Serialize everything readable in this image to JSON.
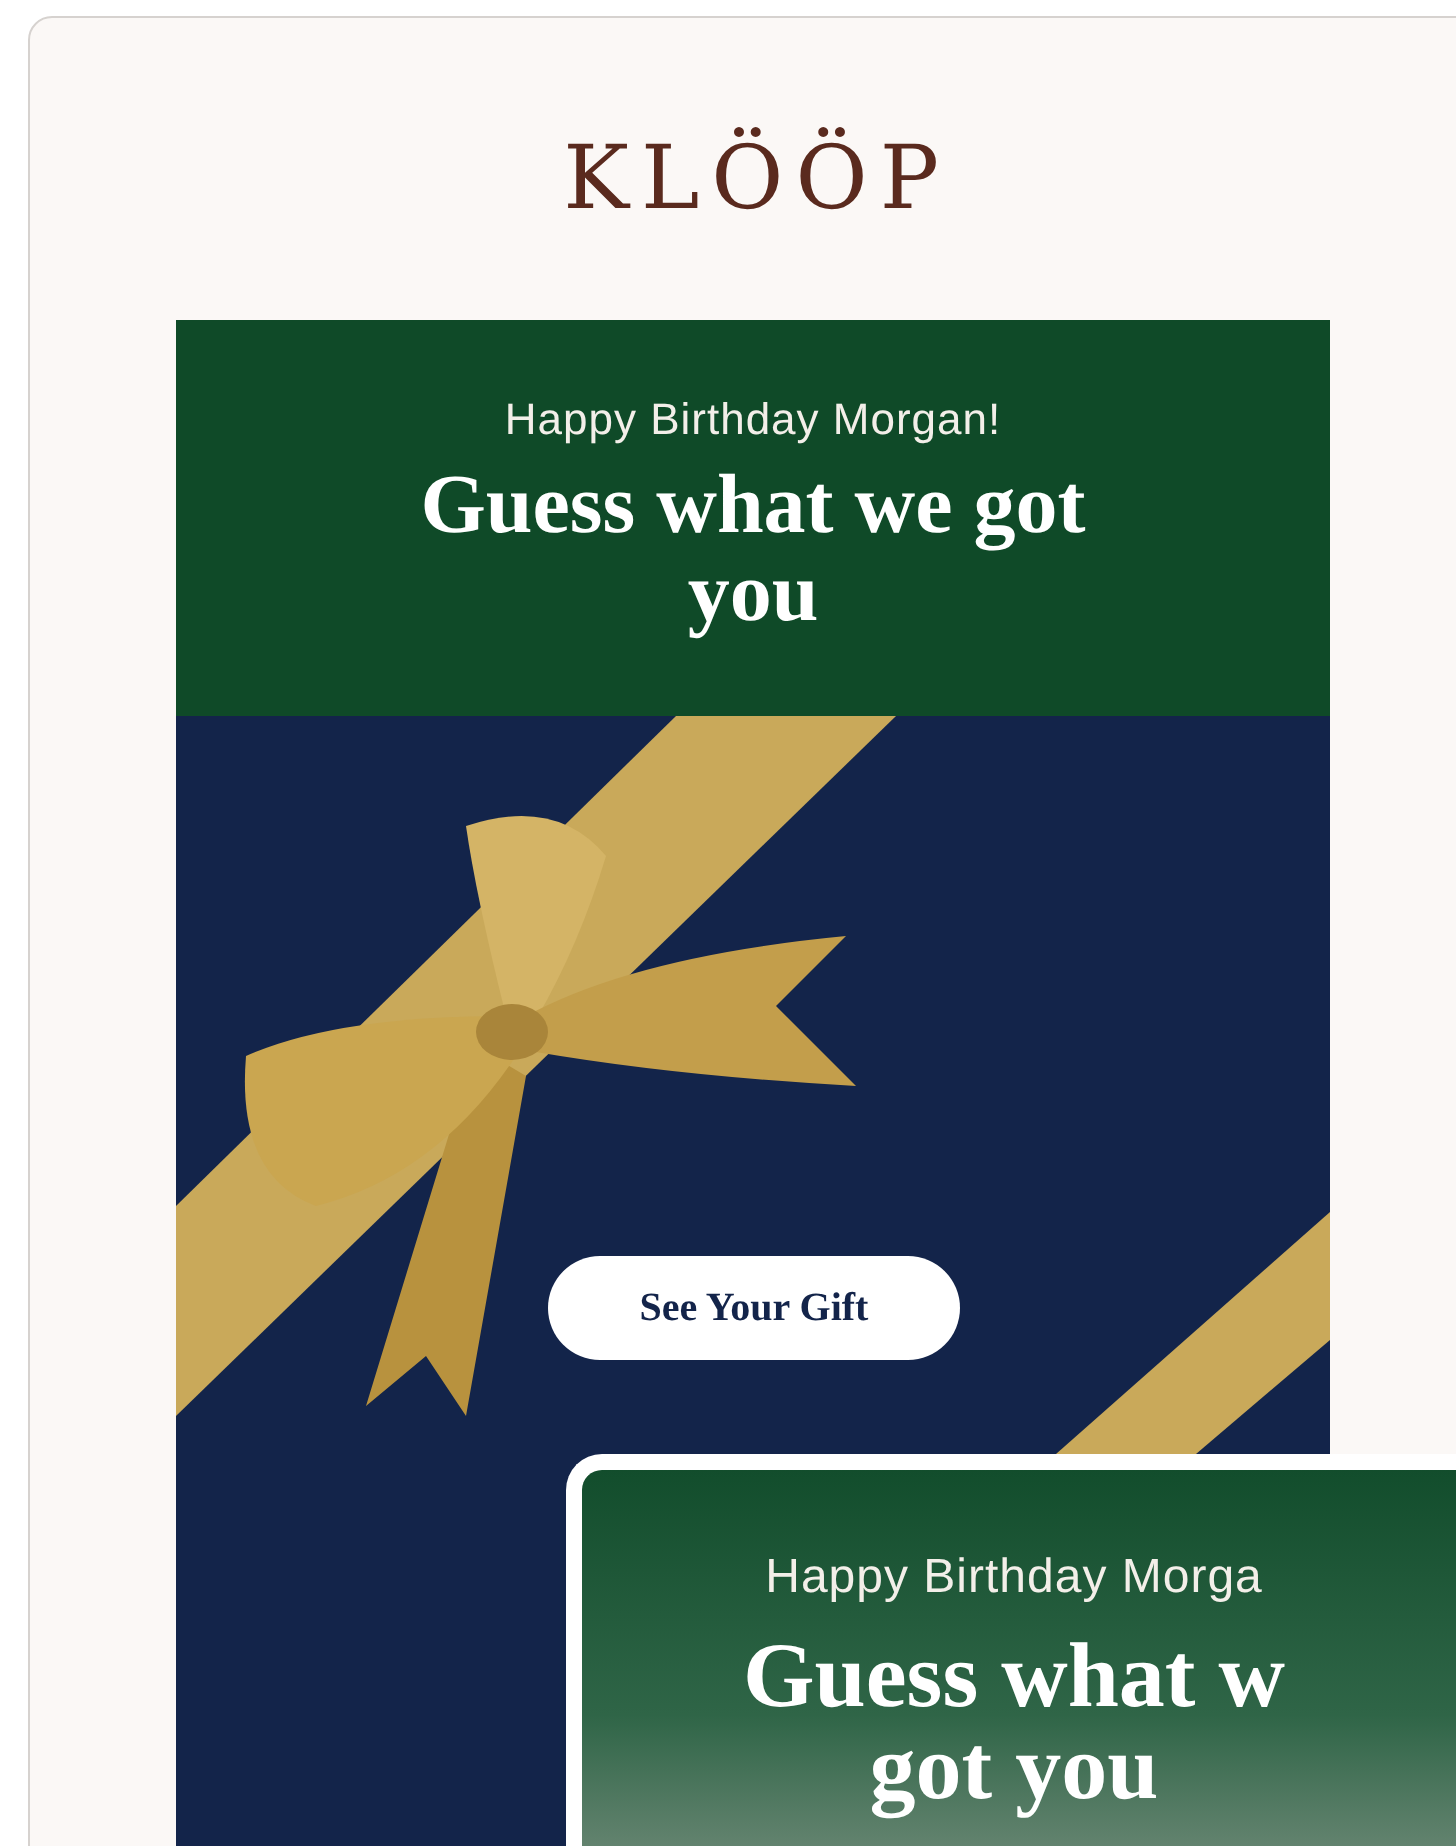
{
  "logo": "KLÖÖP",
  "email": {
    "greeting": "Happy Birthday Morgan!",
    "headline": "Guess what we got you",
    "button": "See Your Gift"
  },
  "preview": {
    "greeting": "Happy Birthday Morga",
    "headline_lines": [
      "Guess what w",
      "got you"
    ]
  }
}
